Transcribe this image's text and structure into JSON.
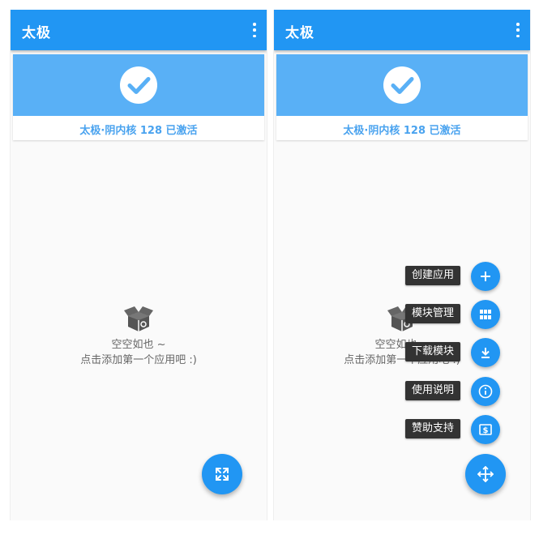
{
  "app": {
    "title": "太极"
  },
  "status": {
    "text": "太极·阴内核 128 已激活"
  },
  "empty": {
    "line1": "空空如也 ~",
    "line2": "点击添加第一个应用吧 :)"
  },
  "speed_dial": [
    {
      "label": "创建应用",
      "icon": "plus-icon"
    },
    {
      "label": "模块管理",
      "icon": "grid-icon"
    },
    {
      "label": "下载模块",
      "icon": "download-icon"
    },
    {
      "label": "使用说明",
      "icon": "info-icon"
    },
    {
      "label": "赞助支持",
      "icon": "money-icon"
    }
  ],
  "colors": {
    "primary": "#2196f3",
    "banner": "#59b0f6",
    "status_text": "#4aa3ef",
    "label_bg": "#333333"
  },
  "icons": {
    "menu": "more-vert-icon",
    "status": "check-circle-icon",
    "empty": "open-box-icon",
    "fab_left": "expand-icon",
    "fab_right": "move-icon"
  }
}
